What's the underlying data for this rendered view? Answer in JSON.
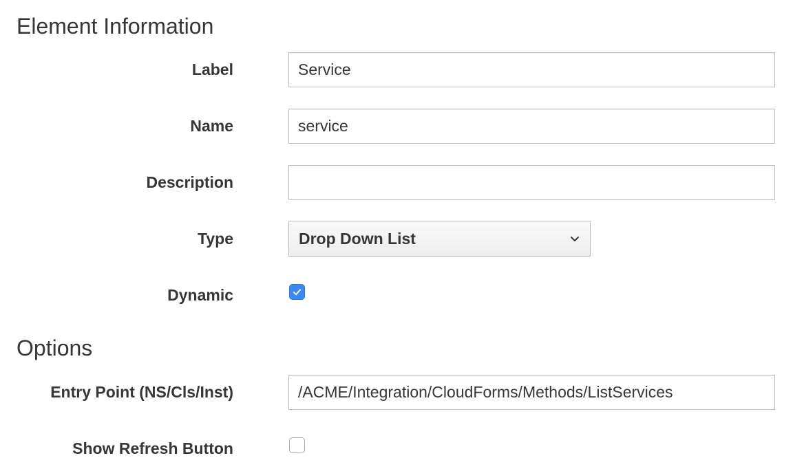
{
  "sections": {
    "element_information": "Element Information",
    "options": "Options"
  },
  "fields": {
    "label": {
      "label": "Label",
      "value": "Service"
    },
    "name": {
      "label": "Name",
      "value": "service"
    },
    "description": {
      "label": "Description",
      "value": ""
    },
    "type": {
      "label": "Type",
      "selected": "Drop Down List"
    },
    "dynamic": {
      "label": "Dynamic",
      "checked": true
    },
    "entry_point": {
      "label": "Entry Point (NS/Cls/Inst)",
      "value": "/ACME/Integration/CloudForms/Methods/ListServices"
    },
    "show_refresh": {
      "label": "Show Refresh Button",
      "checked": false
    }
  },
  "icons": {
    "type_dropdown": "chevron-down-icon",
    "dynamic_checkbox": "check-icon"
  },
  "colors": {
    "checkbox_checked": "#3b88f5",
    "text": "#363636",
    "border": "#bbbbbb"
  }
}
